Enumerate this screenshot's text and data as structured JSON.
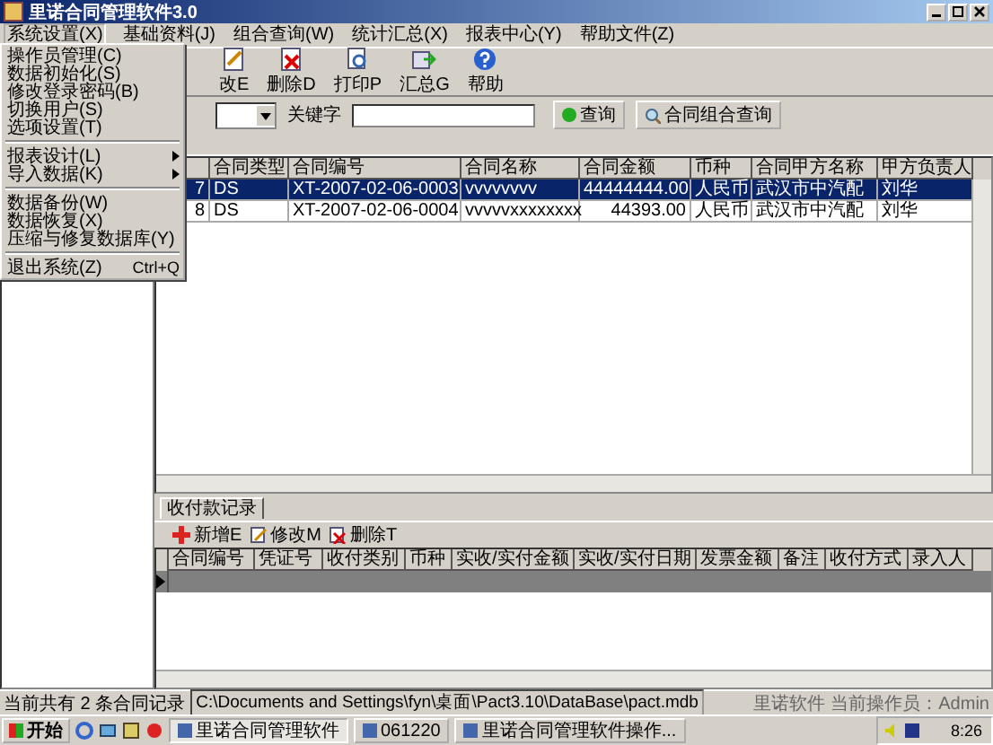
{
  "window": {
    "title": "里诺合同管理软件3.0"
  },
  "menu_bar": [
    {
      "label": "系统设置(X)",
      "selected": true
    },
    {
      "label": "基础资料(J)",
      "selected": false
    },
    {
      "label": "组合查询(W)",
      "selected": false
    },
    {
      "label": "统计汇总(X)",
      "selected": false
    },
    {
      "label": "报表中心(Y)",
      "selected": false
    },
    {
      "label": "帮助文件(Z)",
      "selected": false
    }
  ],
  "dropdown": [
    {
      "kind": "item",
      "label": "操作员管理(C)"
    },
    {
      "kind": "item",
      "label": "数据初始化(S)"
    },
    {
      "kind": "item",
      "label": "修改登录密码(B)"
    },
    {
      "kind": "item",
      "label": "切换用户(S)"
    },
    {
      "kind": "item",
      "label": "选项设置(T)"
    },
    {
      "kind": "separator"
    },
    {
      "kind": "submenu",
      "label": "报表设计(L)"
    },
    {
      "kind": "submenu",
      "label": "导入数据(K)"
    },
    {
      "kind": "separator"
    },
    {
      "kind": "item",
      "label": "数据备份(W)"
    },
    {
      "kind": "item",
      "label": "数据恢复(X)"
    },
    {
      "kind": "item",
      "label": "压缩与修复数据库(Y)"
    },
    {
      "kind": "separator"
    },
    {
      "kind": "item",
      "label": "退出系统(Z)",
      "shortcut": "Ctrl+Q"
    }
  ],
  "toolbar": [
    {
      "kind": "edit",
      "label": "改E"
    },
    {
      "kind": "delete",
      "label": "删除D"
    },
    {
      "kind": "print",
      "label": "打印P"
    },
    {
      "kind": "sum",
      "label": "汇总G"
    },
    {
      "kind": "help",
      "label": "帮助"
    }
  ],
  "filter": {
    "keyword_label": "关键字",
    "search_button": "查询",
    "combo_button": "合同组合查询"
  },
  "contracts": {
    "columns": [
      "",
      "合同类型",
      "合同编号",
      "合同名称",
      "合同金额",
      "币种",
      "合同甲方名称",
      "甲方负责人"
    ],
    "rows": [
      {
        "selected": true,
        "cells": [
          "7",
          "DS",
          "XT-2007-02-06-0003",
          "vvvvvvvv",
          "44444444.00",
          "人民币",
          "武汉市中汽配",
          "刘华"
        ]
      },
      {
        "selected": false,
        "cells": [
          "8",
          "DS",
          "XT-2007-02-06-0004",
          "vvvvvxxxxxxxx",
          "44393.00",
          "人民币",
          "武汉市中汽配",
          "刘华"
        ]
      }
    ]
  },
  "payments": {
    "tab": "收付款记录",
    "actions": [
      {
        "kind": "add",
        "label": "新增E"
      },
      {
        "kind": "edit",
        "label": "修改M"
      },
      {
        "kind": "delete",
        "label": "删除T"
      }
    ],
    "columns": [
      "合同编号",
      "凭证号",
      "收付类别",
      "币种",
      "实收/实付金额",
      "实收/实付日期",
      "发票金额",
      "备注",
      "收付方式",
      "录入人"
    ],
    "rows": [
      {
        "selected": true
      }
    ]
  },
  "status_bar": {
    "record_count": "当前共有 2 条合同记录",
    "db_path": "C:\\Documents and Settings\\fyn\\桌面\\Pact3.10\\DataBase\\pact.mdb",
    "company": "里诺软件",
    "operator": "当前操作员：Admin"
  },
  "taskbar": {
    "start": "开始",
    "tasks": [
      {
        "label": "里诺合同管理软件",
        "selected": true
      },
      {
        "label": "061220",
        "selected": false
      },
      {
        "label": "里诺合同管理软件操作...",
        "selected": false
      }
    ],
    "clock": "8:26"
  }
}
